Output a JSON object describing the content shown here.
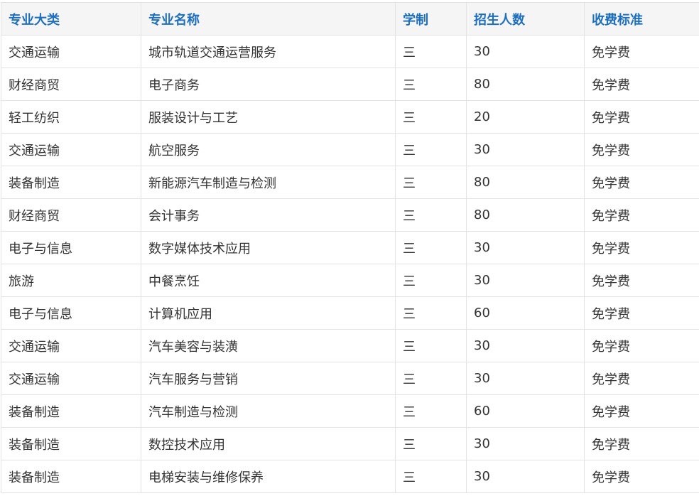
{
  "table": {
    "headers": [
      "专业大类",
      "专业名称",
      "学制",
      "招生人数",
      "收费标准"
    ],
    "rows": [
      [
        "交通运输",
        "城市轨道交通运营服务",
        "三",
        "30",
        "免学费"
      ],
      [
        "财经商贸",
        "电子商务",
        "三",
        "80",
        "免学费"
      ],
      [
        "轻工纺织",
        "服装设计与工艺",
        "三",
        "20",
        "免学费"
      ],
      [
        "交通运输",
        "航空服务",
        "三",
        "30",
        "免学费"
      ],
      [
        "装备制造",
        "新能源汽车制造与检测",
        "三",
        "80",
        "免学费"
      ],
      [
        "财经商贸",
        "会计事务",
        "三",
        "80",
        "免学费"
      ],
      [
        "电子与信息",
        "数字媒体技术应用",
        "三",
        "30",
        "免学费"
      ],
      [
        "旅游",
        "中餐烹饪",
        "三",
        "30",
        "免学费"
      ],
      [
        "电子与信息",
        "计算机应用",
        "三",
        "60",
        "免学费"
      ],
      [
        "交通运输",
        "汽车美容与装潢",
        "三",
        "30",
        "免学费"
      ],
      [
        "交通运输",
        "汽车服务与营销",
        "三",
        "30",
        "免学费"
      ],
      [
        "装备制造",
        "汽车制造与检测",
        "三",
        "60",
        "免学费"
      ],
      [
        "装备制造",
        "数控技术应用",
        "三",
        "30",
        "免学费"
      ],
      [
        "装备制造",
        "电梯安装与维修保养",
        "三",
        "30",
        "免学费"
      ]
    ]
  },
  "colors": {
    "header_text": "#1e6fbf",
    "header_bg": "#f5f5f5",
    "border": "#e3e3e3",
    "body_text": "#333333"
  }
}
